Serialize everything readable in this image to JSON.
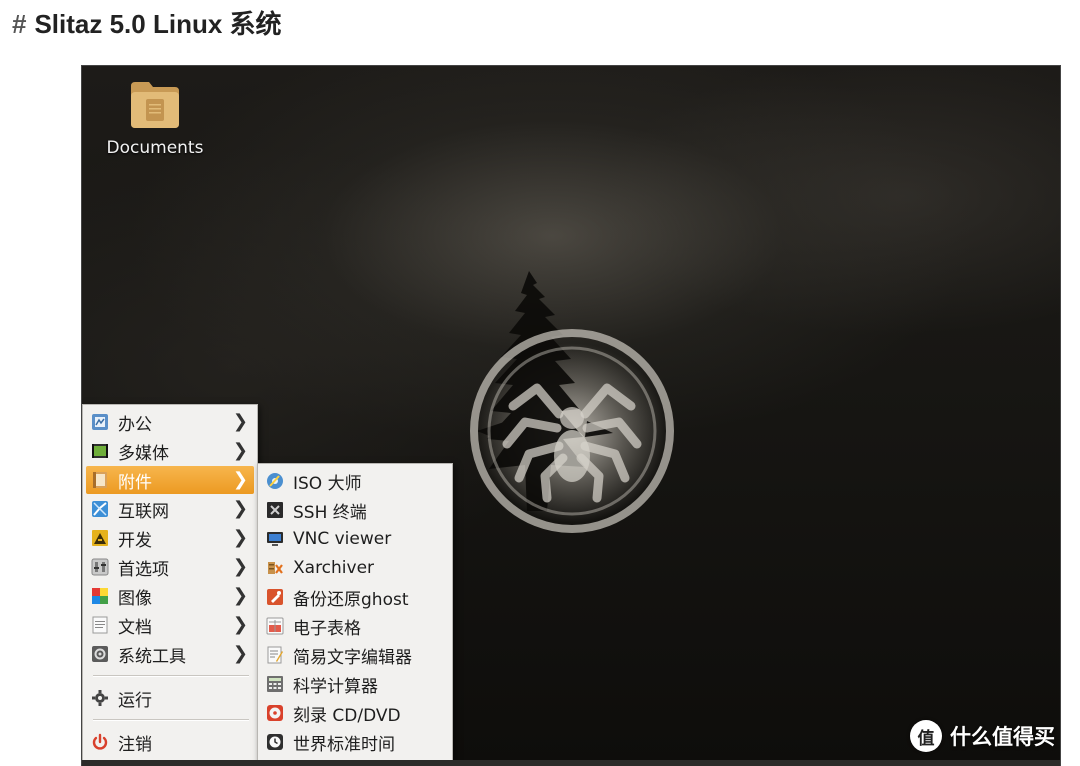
{
  "page": {
    "heading": "Slitaz 5.0 Linux 系统",
    "heading_prefix": "#"
  },
  "desktop": {
    "icons": [
      {
        "label": "Documents",
        "icon": "folder-icon"
      }
    ]
  },
  "menu": {
    "items": [
      {
        "label": "办公",
        "icon": "office-icon",
        "submenu": true
      },
      {
        "label": "多媒体",
        "icon": "multimedia-icon",
        "submenu": true
      },
      {
        "label": "附件",
        "icon": "accessories-icon",
        "submenu": true,
        "active": true
      },
      {
        "label": "互联网",
        "icon": "internet-icon",
        "submenu": true
      },
      {
        "label": "开发",
        "icon": "development-icon",
        "submenu": true
      },
      {
        "label": "首选项",
        "icon": "preferences-icon",
        "submenu": true
      },
      {
        "label": "图像",
        "icon": "graphics-icon",
        "submenu": true
      },
      {
        "label": "文档",
        "icon": "documents-icon",
        "submenu": true
      },
      {
        "label": "系统工具",
        "icon": "system-tools-icon",
        "submenu": true
      },
      {
        "label": "运行",
        "icon": "run-gear-icon"
      },
      {
        "label": "注销",
        "icon": "power-icon"
      }
    ],
    "submenu_arrow": "❯"
  },
  "submenu": {
    "items": [
      {
        "label": "ISO 大师",
        "icon": "iso-master-icon"
      },
      {
        "label": "SSH 终端",
        "icon": "ssh-terminal-icon"
      },
      {
        "label": "VNC viewer",
        "icon": "vnc-monitor-icon"
      },
      {
        "label": "Xarchiver",
        "icon": "archiver-icon"
      },
      {
        "label": "备份还原ghost",
        "icon": "backup-icon"
      },
      {
        "label": "电子表格",
        "icon": "spreadsheet-icon"
      },
      {
        "label": "简易文字编辑器",
        "icon": "text-editor-icon"
      },
      {
        "label": "科学计算器",
        "icon": "calculator-icon"
      },
      {
        "label": "刻录 CD/DVD",
        "icon": "burn-disc-icon"
      },
      {
        "label": "世界标准时间",
        "icon": "clock-icon"
      }
    ]
  },
  "watermark": {
    "logo": "值",
    "text": "什么值得买"
  },
  "colors": {
    "menu_active": "#ec9a22",
    "menu_bg": "#f2f1ef"
  }
}
